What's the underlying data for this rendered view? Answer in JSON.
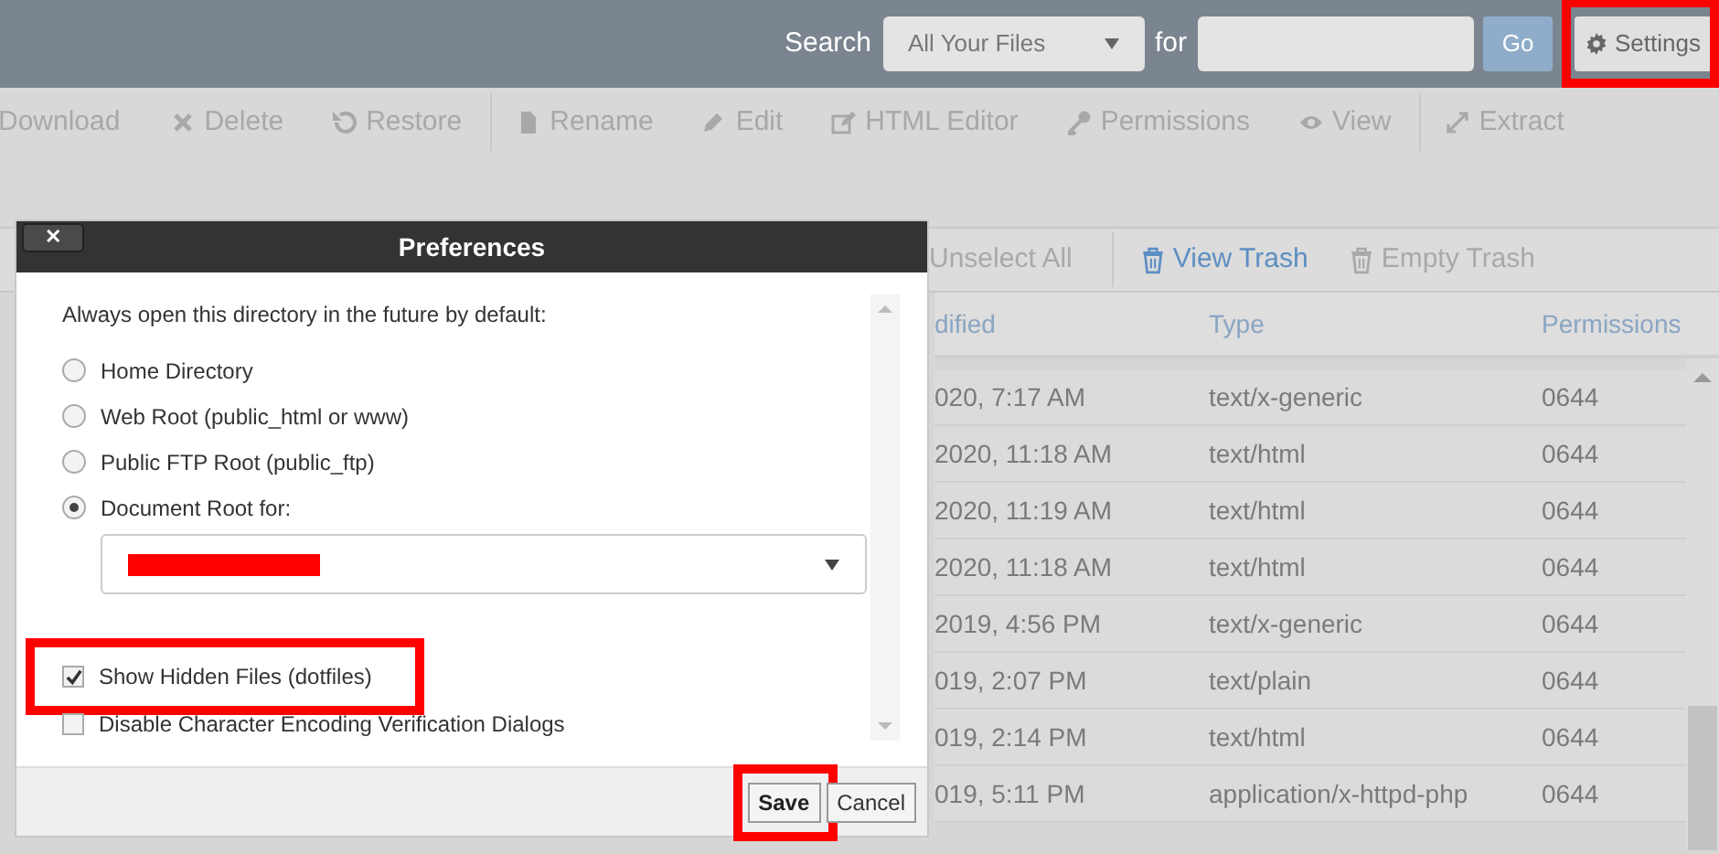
{
  "top_bar": {
    "search_label": "Search",
    "scope_select": {
      "value": "All Your Files"
    },
    "for_label": "for",
    "go_button": "Go",
    "settings_button": {
      "label": "Settings",
      "highlighted": true
    }
  },
  "toolbar": [
    {
      "label": "Download",
      "kind": "none",
      "separator_before": false
    },
    {
      "label": "Delete",
      "kind": "delete",
      "separator_before": false
    },
    {
      "label": "Restore",
      "kind": "restore",
      "separator_before": false
    },
    {
      "label": "Rename",
      "kind": "rename",
      "separator_before": true
    },
    {
      "label": "Edit",
      "kind": "edit",
      "separator_before": false
    },
    {
      "label": "HTML Editor",
      "kind": "html-editor",
      "separator_before": false
    },
    {
      "label": "Permissions",
      "kind": "permissions",
      "separator_before": false
    },
    {
      "label": "View",
      "kind": "view",
      "separator_before": false
    },
    {
      "label": "Extract",
      "kind": "extract",
      "separator_before": true
    }
  ],
  "actions_bar": [
    {
      "label": "Unselect All",
      "kind": "plain"
    },
    {
      "label": "View Trash",
      "kind": "trash-link"
    },
    {
      "label": "Empty Trash",
      "kind": "trash-disabled"
    }
  ],
  "table": {
    "columns": [
      "dified",
      "Type",
      "Permissions"
    ],
    "rows": [
      [
        "020, 7:17 AM",
        "text/x-generic",
        "0644"
      ],
      [
        "2020, 11:18 AM",
        "text/html",
        "0644"
      ],
      [
        "2020, 11:19 AM",
        "text/html",
        "0644"
      ],
      [
        "2020, 11:18 AM",
        "text/html",
        "0644"
      ],
      [
        "2019, 4:56 PM",
        "text/x-generic",
        "0644"
      ],
      [
        "019, 2:07 PM",
        "text/plain",
        "0644"
      ],
      [
        "019, 2:14 PM",
        "text/html",
        "0644"
      ],
      [
        "019, 5:11 PM",
        "application/x-httpd-php",
        "0644"
      ]
    ]
  },
  "dialog": {
    "title": "Preferences",
    "close_label": "✕",
    "prompt": "Always open this directory in the future by default:",
    "radios": [
      {
        "label": "Home Directory",
        "selected": false
      },
      {
        "label": "Web Root (public_html or www)",
        "selected": false
      },
      {
        "label": "Public FTP Root (public_ftp)",
        "selected": false
      },
      {
        "label": "Document Root for:",
        "selected": true
      }
    ],
    "document_root_select": {
      "redacted": true
    },
    "checkboxes": [
      {
        "label": "Show Hidden Files (dotfiles)",
        "checked": true,
        "highlighted": true
      },
      {
        "label": "Disable Character Encoding Verification Dialogs",
        "checked": false,
        "highlighted": false
      }
    ],
    "buttons": [
      {
        "label": "Save",
        "kind": "primary",
        "highlighted": true
      },
      {
        "label": "Cancel",
        "kind": "secondary",
        "highlighted": false
      }
    ]
  }
}
